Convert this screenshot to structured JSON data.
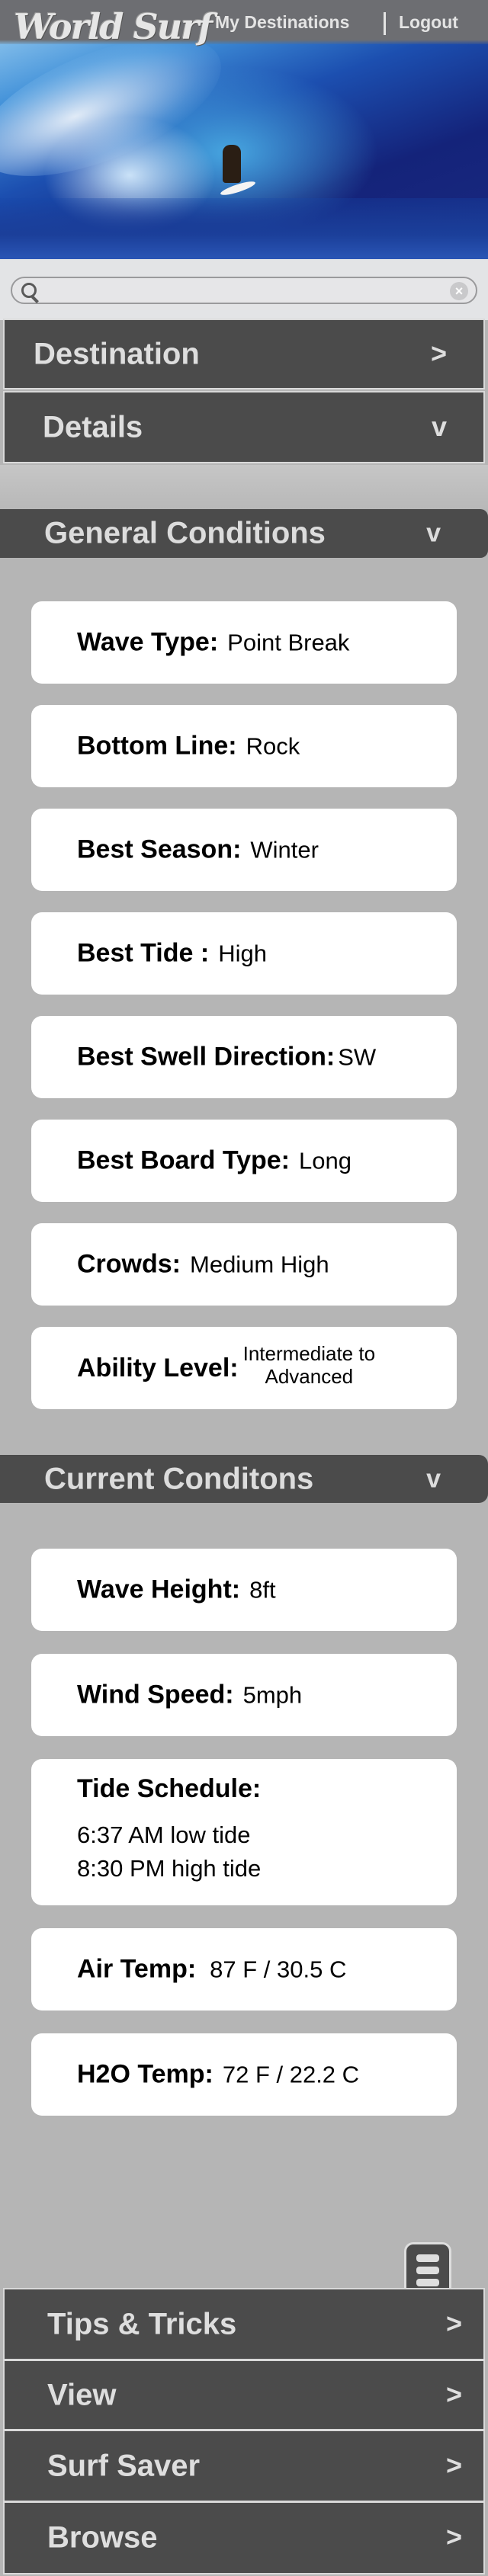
{
  "header": {
    "logo_text": "World Surf",
    "links": [
      {
        "label": "My Destinations"
      },
      {
        "label": "Logout"
      }
    ]
  },
  "search": {
    "placeholder": "",
    "value": ""
  },
  "nav_top": [
    {
      "label": "Destination",
      "chevron": ">"
    },
    {
      "label": "Details",
      "chevron": "v"
    }
  ],
  "general": {
    "title": "General Conditions",
    "chevron": "v",
    "items": [
      {
        "label": "Wave Type:",
        "value": "Point Break"
      },
      {
        "label": "Bottom Line:",
        "value": "Rock"
      },
      {
        "label": "Best Season:",
        "value": "Winter"
      },
      {
        "label": "Best Tide :",
        "value": "High"
      },
      {
        "label": "Best Swell Direction:",
        "value": "SW"
      },
      {
        "label": "Best Board Type:",
        "value": "Long"
      },
      {
        "label": "Crowds:",
        "value": "Medium High"
      },
      {
        "label": "Ability Level:",
        "value_line1": "Intermediate to",
        "value_line2": "Advanced"
      }
    ]
  },
  "current": {
    "title": "Current Conditons",
    "chevron": "v",
    "items": [
      {
        "label": "Wave Height:",
        "value": "8ft"
      },
      {
        "label": "Wind Speed:",
        "value": "5mph"
      },
      {
        "label": "Tide Schedule:",
        "lines": [
          "6:37 AM low tide",
          "8:30 PM high tide"
        ]
      },
      {
        "label": "Air Temp:",
        "value": "87 F / 30.5 C"
      },
      {
        "label": "H2O Temp:",
        "value": "72 F / 22.2 C"
      }
    ]
  },
  "bottom_menu": [
    {
      "label": "Tips & Tricks",
      "chevron": ">"
    },
    {
      "label": "View",
      "chevron": ">"
    },
    {
      "label": "Surf Saver",
      "chevron": ">"
    },
    {
      "label": "Browse",
      "chevron": ">"
    }
  ],
  "icons": {
    "menu": "hamburger-menu-icon",
    "search": "search-icon",
    "clear": "clear-icon"
  },
  "colors": {
    "bar": "#4b4b4b",
    "page_bg": "#b5b5b5",
    "card": "#ffffff",
    "bar_text": "#dedede"
  }
}
